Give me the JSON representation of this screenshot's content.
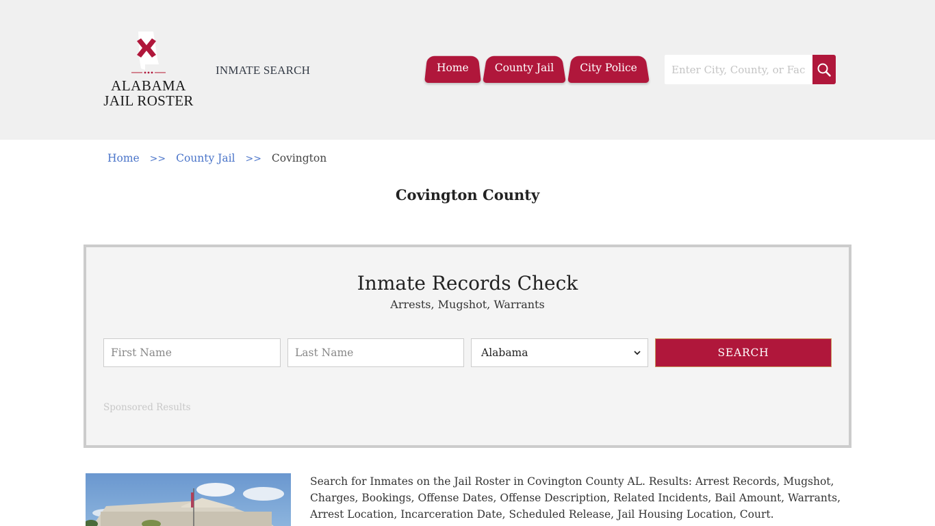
{
  "header": {
    "logo": {
      "line1": "ALABAMA",
      "line2": "JAIL ROSTER",
      "icon": "alabama-state-flag-icon"
    },
    "tagline": "INMATE SEARCH",
    "nav": [
      {
        "label": "Home"
      },
      {
        "label": "County Jail"
      },
      {
        "label": "City Police"
      }
    ],
    "search": {
      "placeholder": "Enter City, County, or Facility",
      "value": "",
      "icon": "search-icon"
    }
  },
  "breadcrumb": {
    "items": [
      {
        "label": "Home"
      },
      {
        "label": "County Jail"
      },
      {
        "label": "Covington"
      }
    ],
    "separator": ">>"
  },
  "page_title": "Covington County",
  "records_check": {
    "title": "Inmate Records Check",
    "subtitle": "Arrests, Mugshot, Warrants",
    "first_name": {
      "placeholder": "First Name",
      "value": ""
    },
    "last_name": {
      "placeholder": "Last Name",
      "value": ""
    },
    "state": {
      "selected": "Alabama"
    },
    "submit_label": "SEARCH",
    "sponsored": "Sponsored Results"
  },
  "content": {
    "image_alt": "Covington County courthouse",
    "description": "Search for Inmates on the Jail Roster in Covington County AL. Results: Arrest Records, Mugshot, Charges, Bookings, Offense Dates, Offense Description, Related Incidents, Bail Amount, Warrants, Arrest Location, Incarceration Date, Scheduled Release, Jail Housing Location, Court."
  },
  "colors": {
    "brand": "#b0173b",
    "link": "#4a74c9",
    "header_bg": "#f0f0f0",
    "box_bg": "#f4f4f4",
    "box_border": "#cccccc"
  }
}
